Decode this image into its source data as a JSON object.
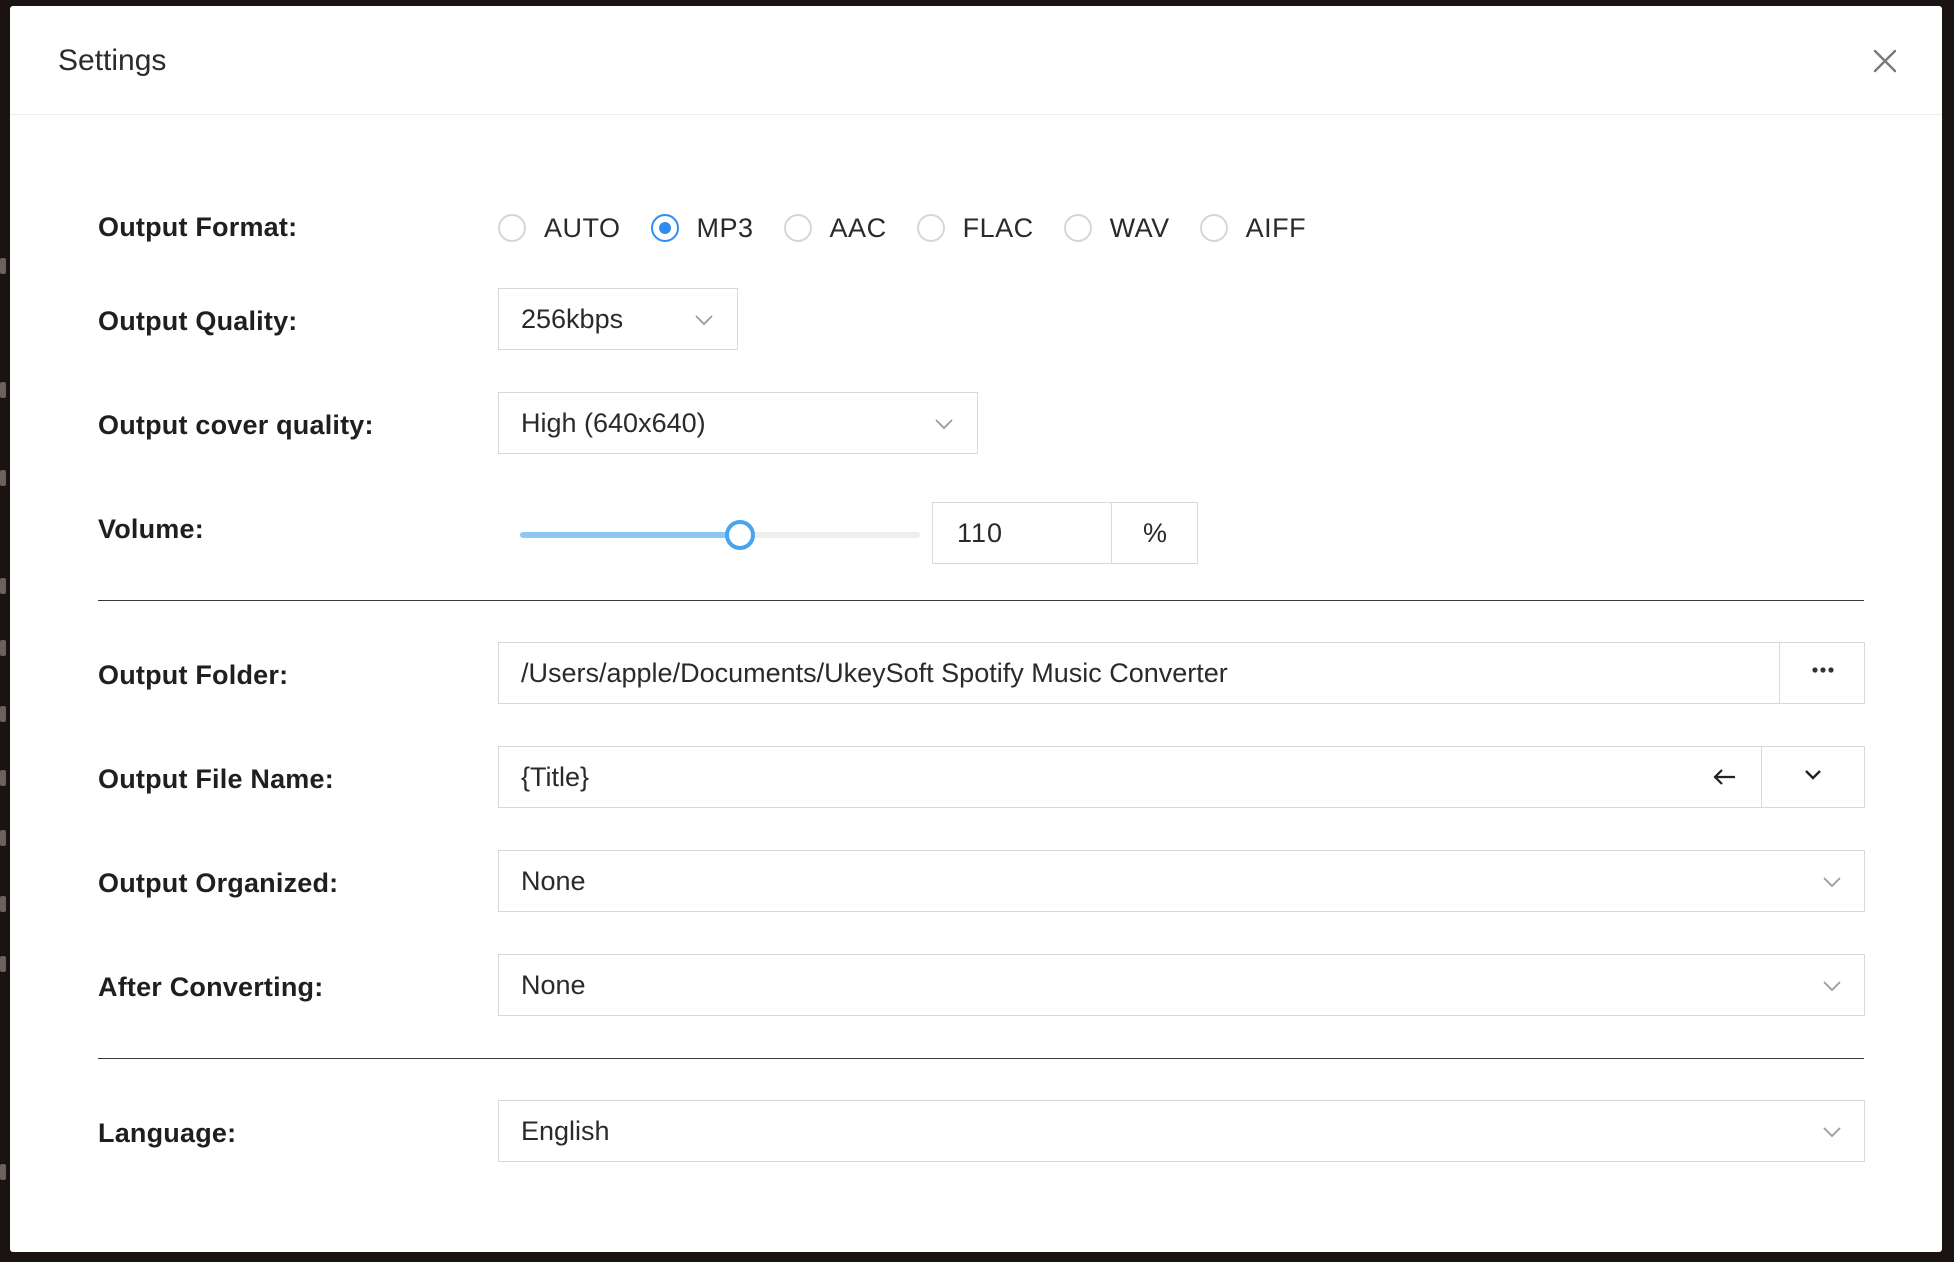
{
  "dialog": {
    "title": "Settings"
  },
  "output_format": {
    "label": "Output Format:",
    "options": [
      "AUTO",
      "MP3",
      "AAC",
      "FLAC",
      "WAV",
      "AIFF"
    ],
    "selected": "MP3"
  },
  "output_quality": {
    "label": "Output Quality:",
    "value": "256kbps"
  },
  "output_cover_quality": {
    "label": "Output cover quality:",
    "value": "High (640x640)"
  },
  "volume": {
    "label": "Volume:",
    "value": "110",
    "unit": "%",
    "slider_fraction": 0.55
  },
  "output_folder": {
    "label": "Output Folder:",
    "value": "/Users/apple/Documents/UkeySoft Spotify Music Converter",
    "browse_label": "···"
  },
  "output_file_name": {
    "label": "Output File Name:",
    "value": "{Title}"
  },
  "output_organized": {
    "label": "Output Organized:",
    "value": "None"
  },
  "after_converting": {
    "label": "After Converting:",
    "value": "None"
  },
  "language": {
    "label": "Language:",
    "value": "English"
  },
  "colors": {
    "accent": "#2f8df2",
    "slider_fill": "#8cc8f5",
    "border": "#d9d9d9"
  }
}
